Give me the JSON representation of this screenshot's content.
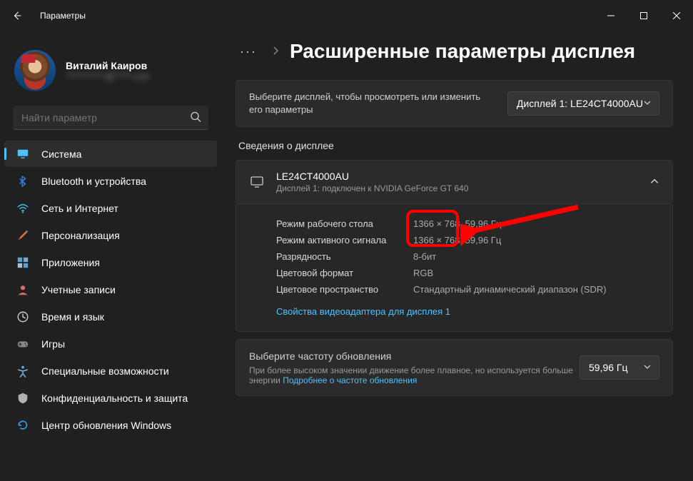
{
  "window": {
    "title": "Параметры"
  },
  "profile": {
    "name": "Виталий Каиров",
    "email": "************@*****.com"
  },
  "search": {
    "placeholder": "Найти параметр"
  },
  "nav": {
    "items": [
      {
        "icon": "display",
        "label": "Система",
        "color": "#4cc2ff",
        "active": true
      },
      {
        "icon": "bluetooth",
        "label": "Bluetooth и устройства",
        "color": "#2f7de0"
      },
      {
        "icon": "wifi",
        "label": "Сеть и Интернет",
        "color": "#3cc0e0"
      },
      {
        "icon": "brush",
        "label": "Персонализация",
        "color": "#e07030"
      },
      {
        "icon": "apps",
        "label": "Приложения",
        "color": "#5aa0d0"
      },
      {
        "icon": "user",
        "label": "Учетные записи",
        "color": "#d86a6a"
      },
      {
        "icon": "clock",
        "label": "Время и язык",
        "color": "#c8c8c8"
      },
      {
        "icon": "game",
        "label": "Игры",
        "color": "#8a8a8a"
      },
      {
        "icon": "access",
        "label": "Специальные возможности",
        "color": "#6ab0e0"
      },
      {
        "icon": "shield",
        "label": "Конфиденциальность и защита",
        "color": "#b0b0b0"
      },
      {
        "icon": "update",
        "label": "Центр обновления Windows",
        "color": "#3ca0e0"
      }
    ]
  },
  "header": {
    "dots": "···",
    "title": "Расширенные параметры дисплея"
  },
  "select_display": {
    "desc": "Выберите дисплей, чтобы просмотреть или изменить его параметры",
    "value": "Дисплей 1: LE24CT4000AU"
  },
  "info_section_label": "Сведения о дисплее",
  "display_info": {
    "title": "LE24CT4000AU",
    "sub": "Дисплей 1: подключен к NVIDIA GeForce GT 640",
    "rows": [
      {
        "label": "Режим рабочего стола",
        "value": "1366 × 768, 59,96 Гц"
      },
      {
        "label": "Режим активного сигнала",
        "value": "1366 × 768, 59,96 Гц"
      },
      {
        "label": "Разрядность",
        "value": "8-бит"
      },
      {
        "label": "Цветовой формат",
        "value": "RGB"
      },
      {
        "label": "Цветовое пространство",
        "value": "Стандартный динамический диапазон (SDR)"
      }
    ],
    "link": "Свойства видеоадаптера для дисплея 1"
  },
  "refresh": {
    "title": "Выберите частоту обновления",
    "desc_pre": "При более высоком значении движение более плавное, но используется больше энергии ",
    "link": "Подробнее о частоте обновления",
    "value": "59,96 Гц"
  }
}
